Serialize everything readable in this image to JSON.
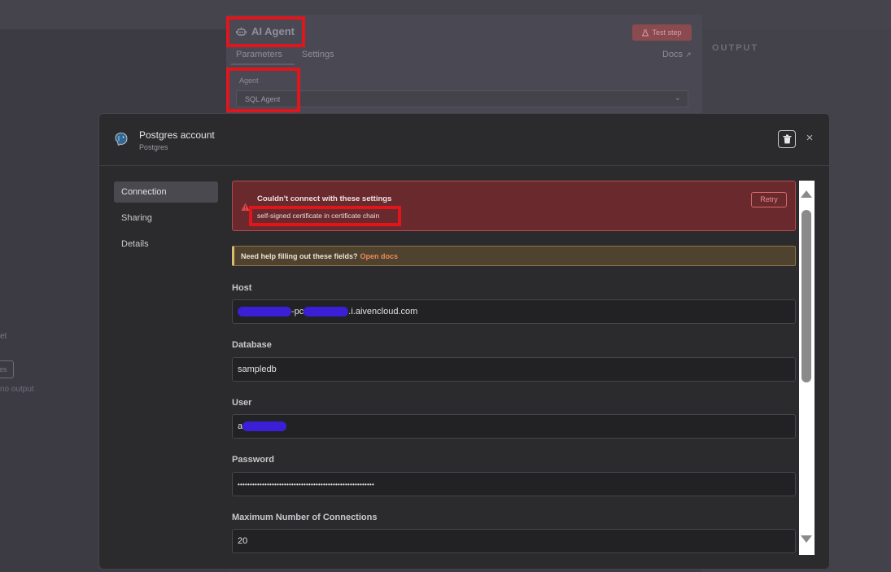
{
  "background": {
    "node_title": "AI Agent",
    "test_step_label": "Test step",
    "tabs": [
      "Parameters",
      "Settings"
    ],
    "docs_label": "Docs",
    "output_label": "OUTPUT",
    "agent_label": "Agent",
    "agent_value": "SQL Agent",
    "fragment_1": "et",
    "fragment_2": "es",
    "fragment_3": "no output"
  },
  "modal": {
    "title": "Postgres account",
    "subtitle": "Postgres",
    "sidebar": [
      {
        "label": "Connection",
        "active": true
      },
      {
        "label": "Sharing",
        "active": false
      },
      {
        "label": "Details",
        "active": false
      }
    ],
    "error": {
      "title": "Couldn't connect with these settings",
      "message": "self-signed certificate in certificate chain",
      "retry_label": "Retry"
    },
    "help": {
      "text": "Need help filling out these fields?",
      "link": "Open docs"
    },
    "fields": {
      "host": {
        "label": "Host",
        "value_mid": "-pc",
        "value_end": ".i.aivencloud.com"
      },
      "database": {
        "label": "Database",
        "value": "sampledb"
      },
      "user": {
        "label": "User",
        "value": "a"
      },
      "password": {
        "label": "Password",
        "value": "••••••••••••••••••••••••••••••••••••••••••••••••••••••••"
      },
      "max_connections": {
        "label": "Maximum Number of Connections",
        "value": "20"
      }
    }
  },
  "colors": {
    "error_bg": "#6a2a2d",
    "help_bg": "#4f4330",
    "redaction": "#3b1fd6",
    "annotation": "#e1151c"
  }
}
